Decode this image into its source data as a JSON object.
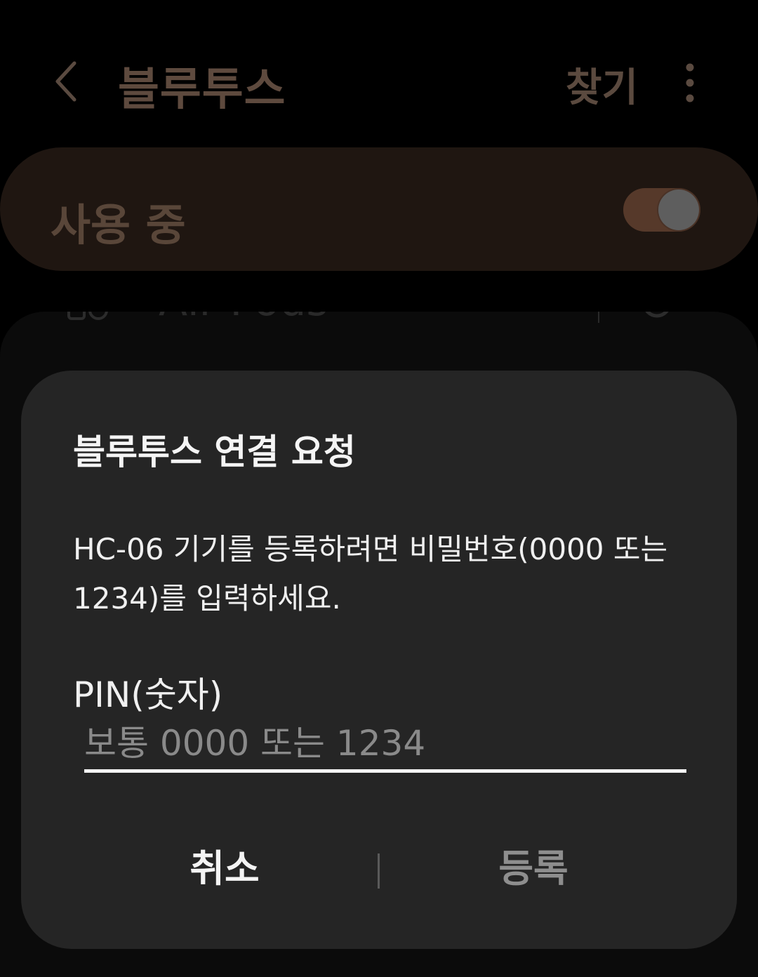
{
  "appbar": {
    "back_icon": "chevron-left-icon",
    "title": "블루투스",
    "search_label": "찾기",
    "more_icon": "more-vertical-icon"
  },
  "master_switch": {
    "label": "사용 중",
    "state": "on"
  },
  "paired_devices": [
    {
      "name": "Air Pods",
      "icon": "earbuds-icon",
      "settings_icon": "gear-icon"
    }
  ],
  "dialog": {
    "title": "블루투스 연결 요청",
    "message": "HC-06 기기를 등록하려면 비밀번호(0000 또는 1234)를 입력하세요.",
    "pin_label": "PIN(숫자)",
    "pin_value": "",
    "pin_placeholder": "보통 0000 또는 1234",
    "cancel_label": "취소",
    "register_label": "등록"
  },
  "colors": {
    "background": "#000000",
    "dialog_background": "#252525",
    "switch_card": "#1f1611",
    "toggle_track": "#56392a",
    "dimmed_text": "#5e4a3e",
    "register_text": "#8e8e8e"
  }
}
